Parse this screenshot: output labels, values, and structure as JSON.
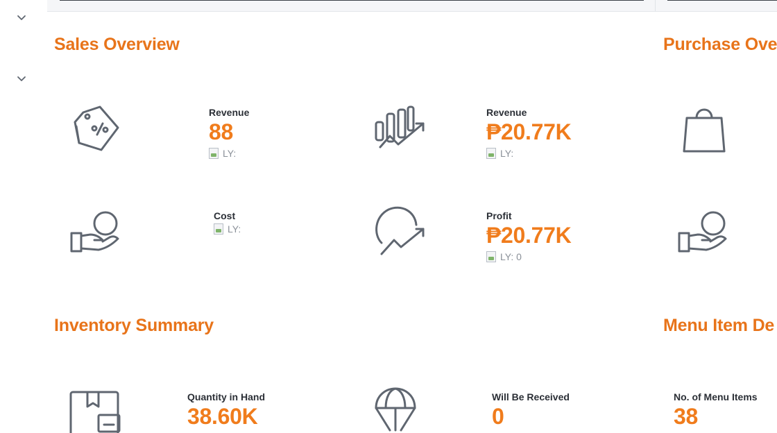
{
  "colors": {
    "accent": "#e8741a",
    "value": "#f07c1c",
    "icon": "#5f6670"
  },
  "sections": {
    "sales_overview": {
      "title": "Sales Overview"
    },
    "purchase_overview": {
      "title": "Purchase Ove"
    },
    "inventory_summary": {
      "title": "Inventory Summary"
    },
    "menu_item_details": {
      "title": "Menu Item De"
    }
  },
  "sales": {
    "revenue_count": {
      "label": "Revenue",
      "value": "88",
      "ly": "LY:",
      "icon": "price-tag-icon"
    },
    "revenue_amount": {
      "label": "Revenue",
      "value": "₱20.77K",
      "ly": "LY:",
      "icon": "bar-chart-trend-icon"
    },
    "cost": {
      "label": "Cost",
      "ly": "LY:",
      "icon": "hand-coin-icon"
    },
    "profit": {
      "label": "Profit",
      "value": "₱20.77K",
      "ly": "LY: 0",
      "icon": "profit-trend-icon"
    }
  },
  "purchase": {
    "bag_icon": "shopping-bag-icon",
    "hand_icon": "hand-coin-icon"
  },
  "inventory": {
    "quantity_in_hand": {
      "label": "Quantity in Hand",
      "value": "38.60K",
      "icon": "box-icon"
    },
    "will_be_received": {
      "label": "Will Be Received",
      "value": "0",
      "icon": "parachute-icon"
    }
  },
  "menu_items": {
    "count": {
      "label": "No. of Menu Items",
      "value": "38"
    }
  }
}
